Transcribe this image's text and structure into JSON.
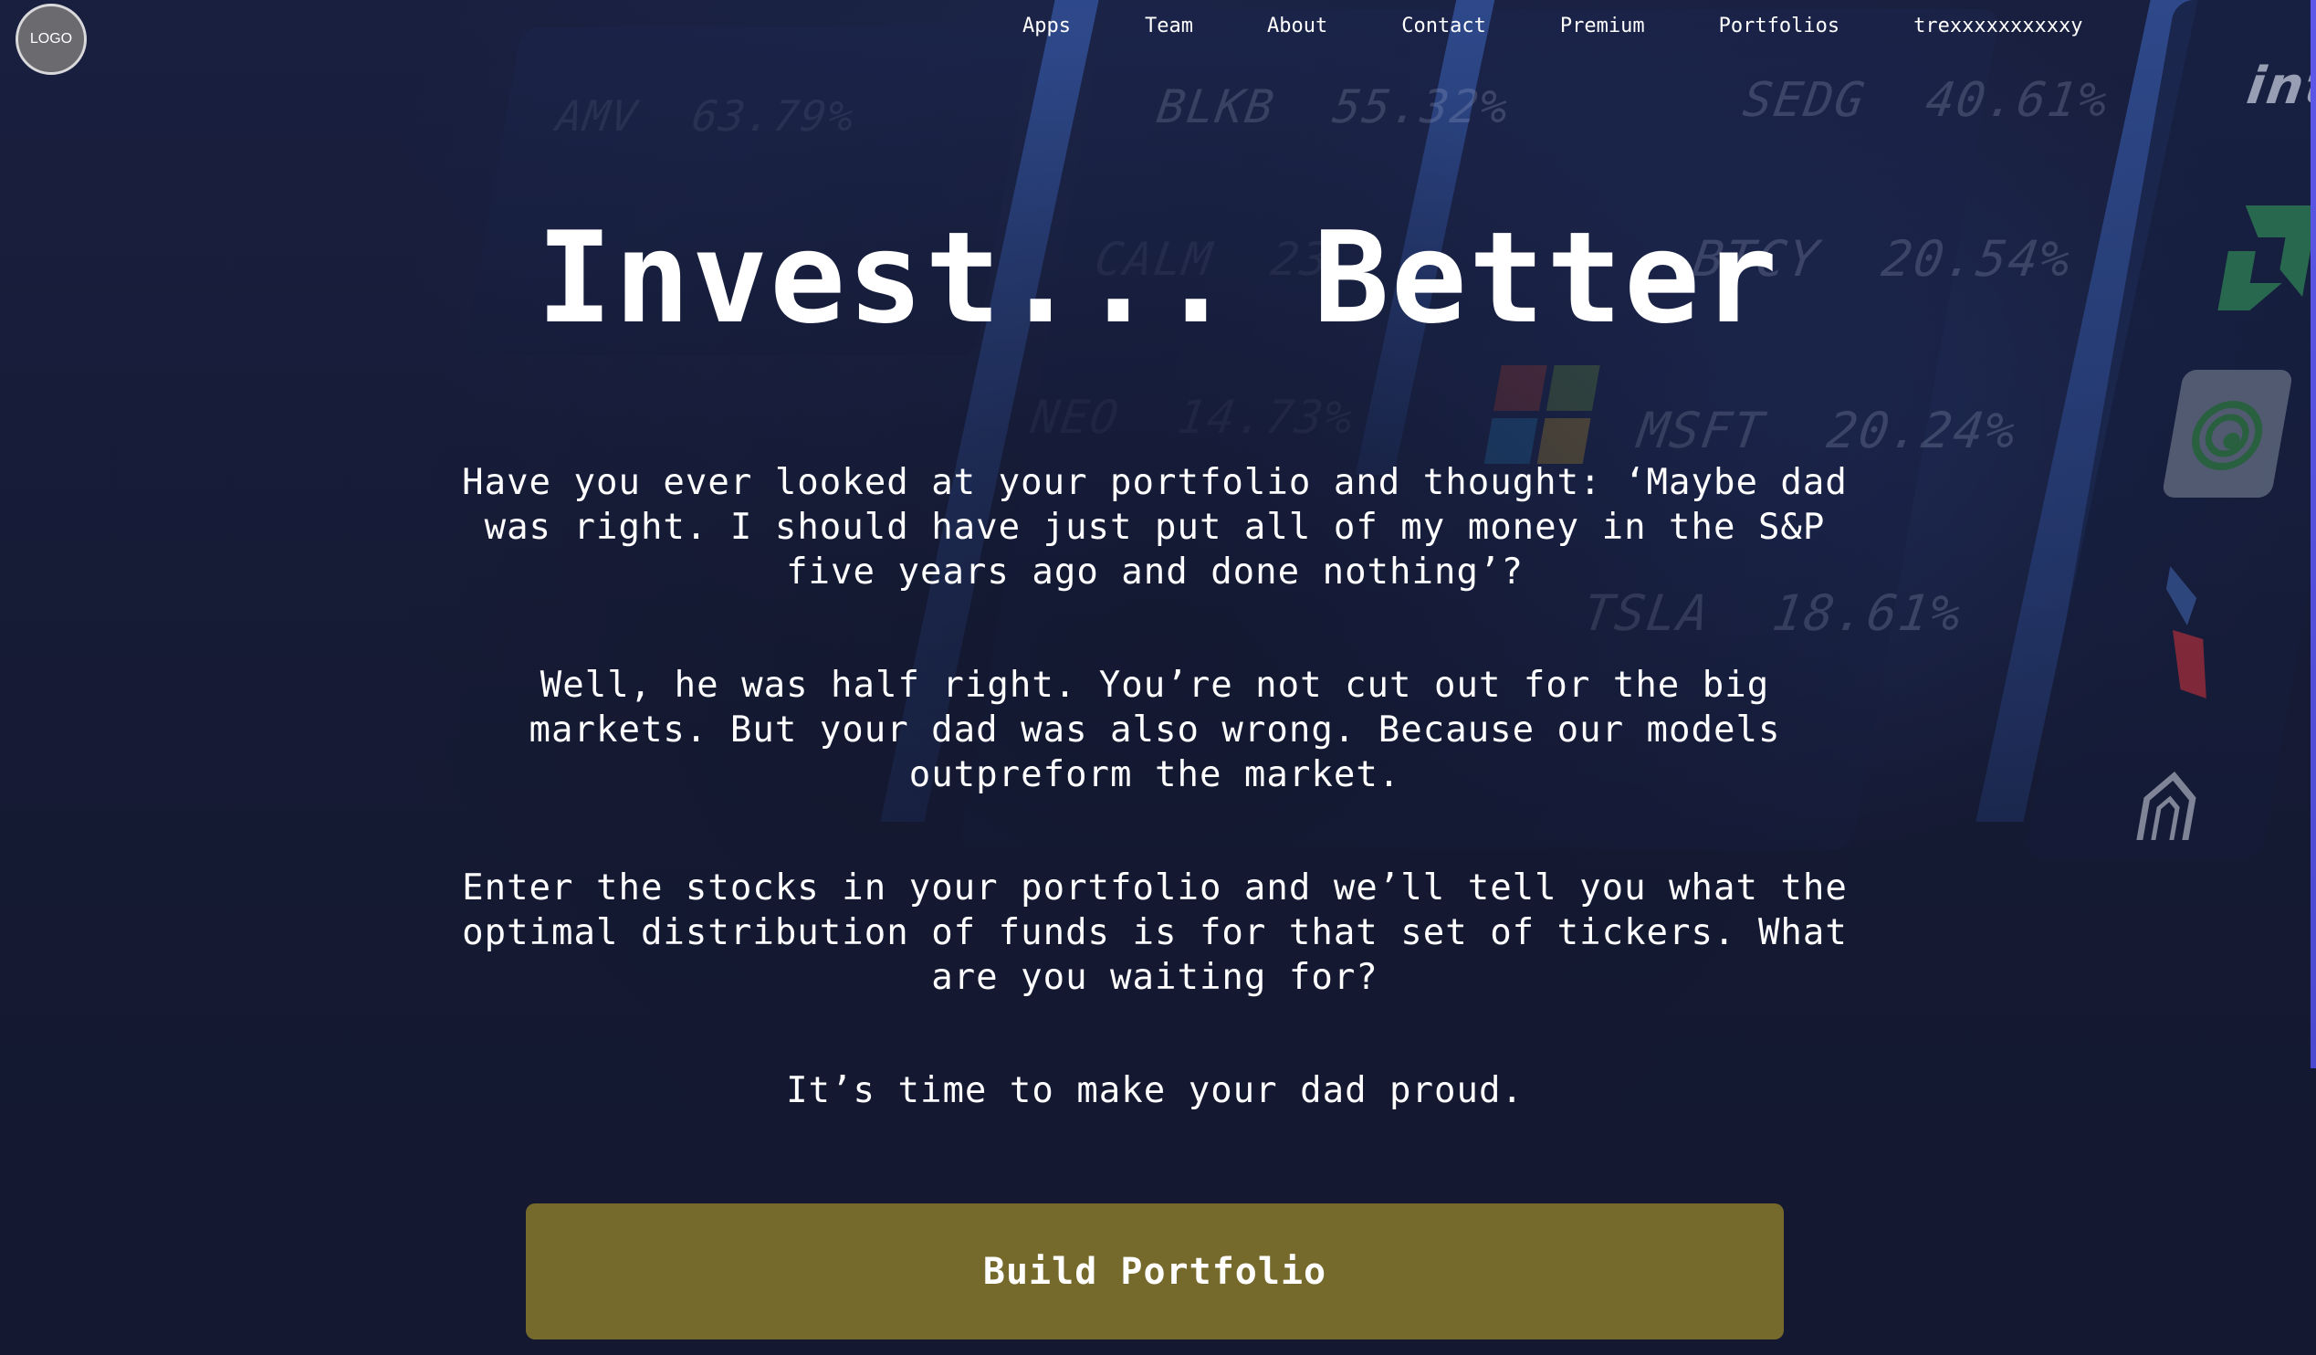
{
  "brand": {
    "logo_text": "LOGO"
  },
  "nav": {
    "items": [
      {
        "label": "Apps"
      },
      {
        "label": "Team"
      },
      {
        "label": "About"
      },
      {
        "label": "Contact"
      },
      {
        "label": "Premium"
      },
      {
        "label": "Portfolios"
      },
      {
        "label": "trexxxxxxxxxxy"
      }
    ]
  },
  "hero": {
    "title": "Invest... Better",
    "paragraphs": [
      "Have you ever looked at your portfolio and thought: ‘Maybe dad was right. I should have just put all of my money in the S&P five years ago and done nothing’?",
      "Well, he was half right. You’re not cut out for the big markets. But your dad was also wrong. Because our models outpreform the market.",
      "Enter the stocks in your portfolio and we’ll tell you what the optimal distribution of funds is for that set of tickers. What are you waiting for?",
      "It’s time to make your dad proud."
    ],
    "cta_label": "Build Portfolio"
  },
  "background_tickers": [
    {
      "symbol": "AMV",
      "change": "63.79%"
    },
    {
      "symbol": "BLKB",
      "change": "55.32%"
    },
    {
      "symbol": "SEDG",
      "change": "40.61%"
    },
    {
      "symbol": "CALM",
      "change": "23."
    },
    {
      "symbol": "BTCY",
      "change": "20.54%"
    },
    {
      "symbol": "NEO",
      "change": "14.73%"
    },
    {
      "symbol": "MSFT",
      "change": "20.24%"
    },
    {
      "symbol": "TSLA",
      "change": "18.61%"
    }
  ],
  "colors": {
    "background": "#151a33",
    "cta": "#756a2c",
    "text": "#ffffff",
    "logo_circle": "#6a6a6f",
    "scroll_edge": "#5d58e8"
  }
}
